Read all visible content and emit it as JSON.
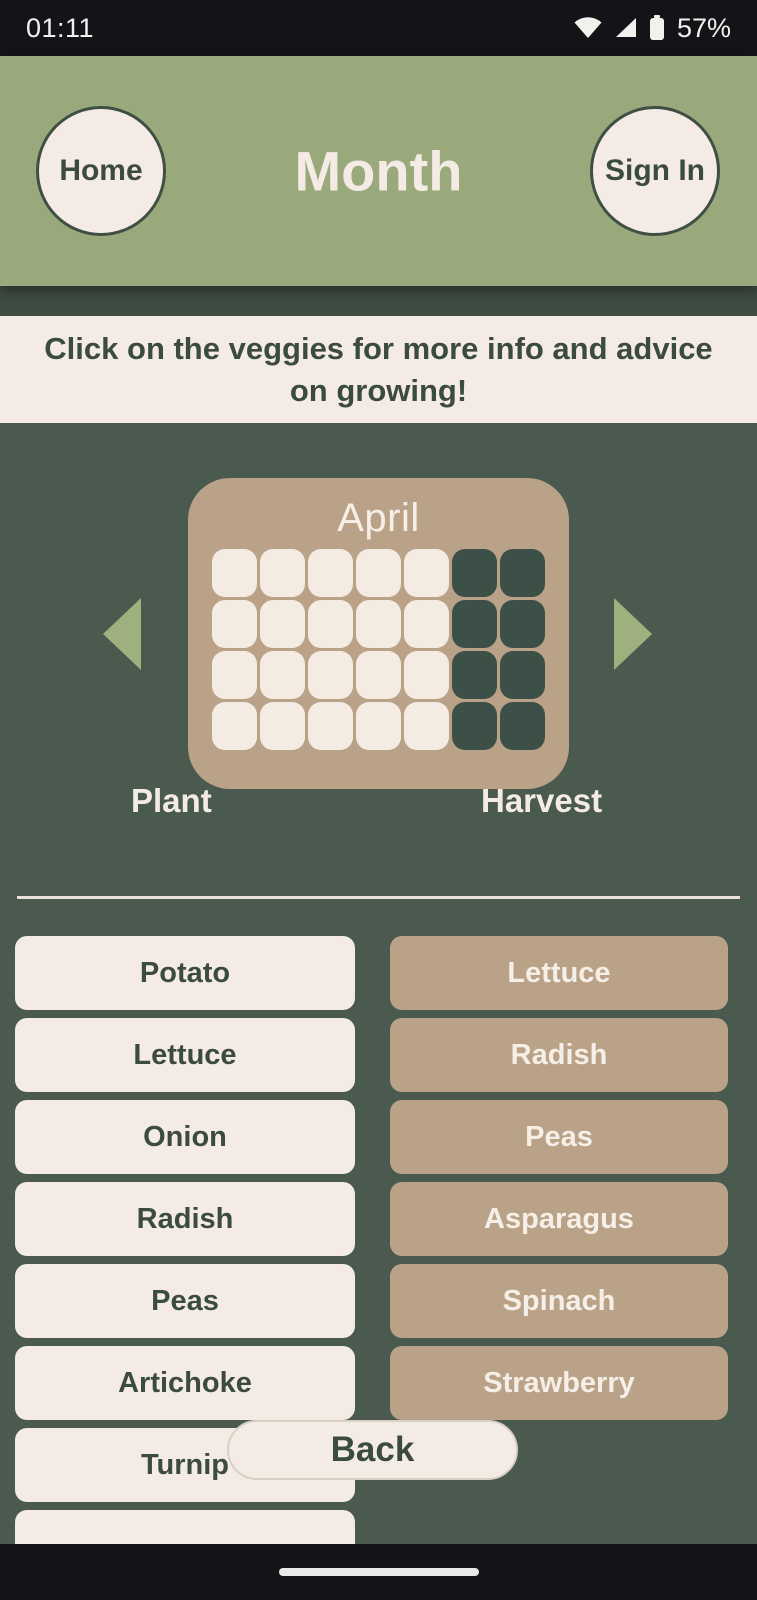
{
  "status_bar": {
    "time": "01:11",
    "battery_percent": "57%",
    "icons": [
      "wifi-icon",
      "cellular-signal-icon",
      "battery-icon"
    ]
  },
  "header": {
    "title": "Month",
    "home_label": "Home",
    "sign_in_label": "Sign In",
    "background_color": "#9aa97c",
    "text_color": "#f4ece4"
  },
  "banner": {
    "text": "Click on the veggies for more info and advice on growing!",
    "background_color": "#f4ece4",
    "text_color": "#3c4b3f"
  },
  "calendar": {
    "month": "April",
    "prev_arrow": "left-triangle-icon",
    "next_arrow": "right-triangle-icon",
    "card_color": "#b9a288",
    "plant_cell_color": "#f4ece2",
    "harvest_cell_color": "#3c5047",
    "columns": 7,
    "rows": 4,
    "cells": [
      "plant",
      "plant",
      "plant",
      "plant",
      "plant",
      "harvest",
      "harvest",
      "plant",
      "plant",
      "plant",
      "plant",
      "plant",
      "harvest",
      "harvest",
      "plant",
      "plant",
      "plant",
      "plant",
      "plant",
      "harvest",
      "harvest",
      "plant",
      "plant",
      "plant",
      "plant",
      "plant",
      "harvest",
      "harvest"
    ]
  },
  "columns": {
    "plant_heading": "Plant",
    "harvest_heading": "Harvest"
  },
  "plant_list": [
    "Potato",
    "Lettuce",
    "Onion",
    "Radish",
    "Peas",
    "Artichoke",
    "Turnip",
    ""
  ],
  "harvest_list": [
    "Lettuce",
    "Radish",
    "Peas",
    "Asparagus",
    "Spinach",
    "Strawberry"
  ],
  "back_button": {
    "label": "Back"
  },
  "theme": {
    "page_background": "#4a5a4f",
    "cream": "#f4ece4",
    "dark_green": "#3c4b3f",
    "sage": "#9aa97c",
    "tan": "#b9a288"
  }
}
